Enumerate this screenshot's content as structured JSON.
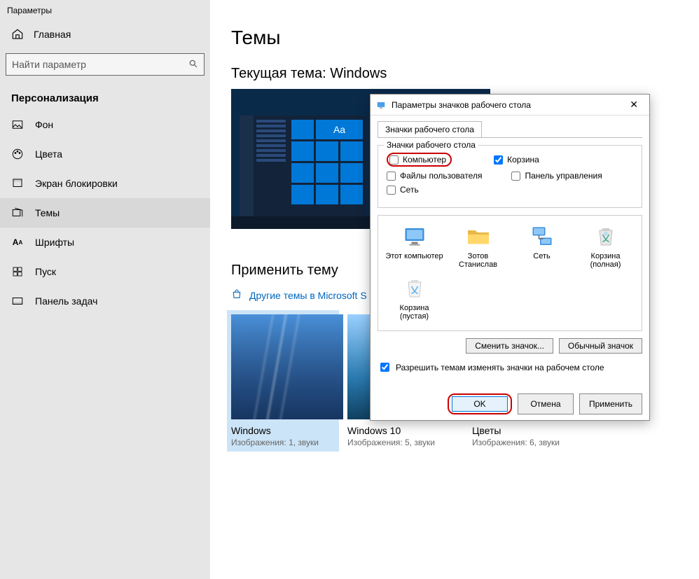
{
  "app_title": "Параметры",
  "home_label": "Главная",
  "search_placeholder": "Найти параметр",
  "section_title": "Персонализация",
  "nav": [
    {
      "label": "Фон"
    },
    {
      "label": "Цвета"
    },
    {
      "label": "Экран блокировки"
    },
    {
      "label": "Темы"
    },
    {
      "label": "Шрифты"
    },
    {
      "label": "Пуск"
    },
    {
      "label": "Панель задач"
    }
  ],
  "page_title": "Темы",
  "current_theme_label": "Текущая тема: Windows",
  "preview_tile_text": "Aa",
  "apply_theme_title": "Применить тему",
  "store_link": "Другие темы в Microsoft S",
  "themes": [
    {
      "name": "Windows",
      "sub": "Изображения: 1, звуки"
    },
    {
      "name": "Windows 10",
      "sub": "Изображения: 5, звуки"
    },
    {
      "name": "Цветы",
      "sub": "Изображения: 6, звуки"
    }
  ],
  "dialog": {
    "title": "Параметры значков рабочего стола",
    "tab": "Значки рабочего стола",
    "group_title": "Значки рабочего стола",
    "checks": {
      "computer": {
        "label": "Компьютер",
        "checked": false
      },
      "recycle": {
        "label": "Корзина",
        "checked": true
      },
      "userfiles": {
        "label": "Файлы пользователя",
        "checked": false
      },
      "cpanel": {
        "label": "Панель управления",
        "checked": false
      },
      "network": {
        "label": "Сеть",
        "checked": false
      }
    },
    "icons": [
      {
        "name": "Этот компьютер"
      },
      {
        "name": "Зотов Станислав"
      },
      {
        "name": "Сеть"
      },
      {
        "name": "Корзина (полная)"
      },
      {
        "name": "Корзина (пустая)"
      }
    ],
    "change_icon": "Сменить значок...",
    "default_icon": "Обычный значок",
    "allow_themes": {
      "label": "Разрешить темам изменять значки на рабочем столе",
      "checked": true
    },
    "ok": "OK",
    "cancel": "Отмена",
    "apply": "Применить"
  }
}
